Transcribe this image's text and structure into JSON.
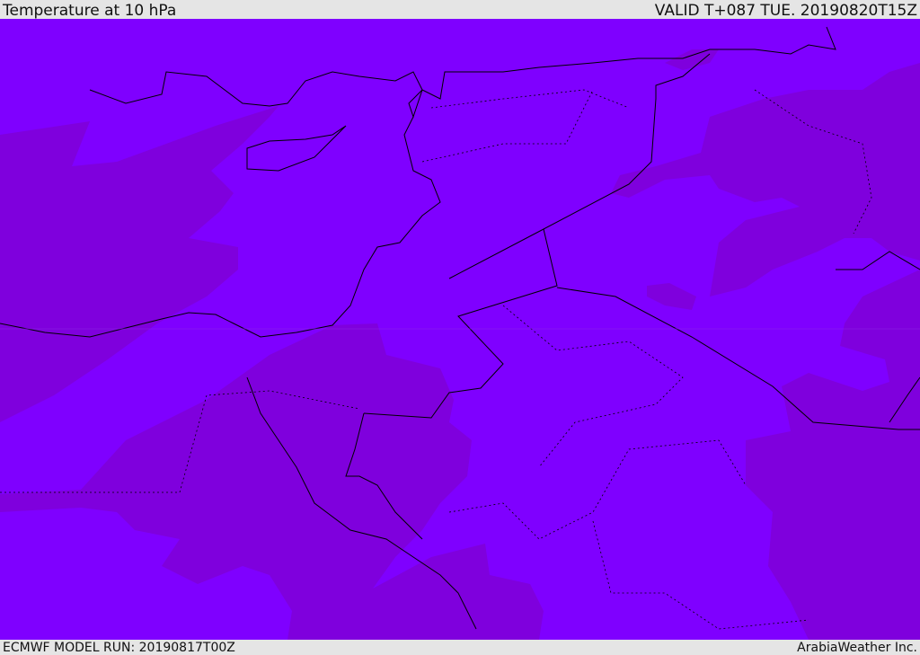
{
  "header": {
    "title": "Temperature at 10 hPa",
    "valid": "VALID T+087 TUE. 20190820T15Z"
  },
  "footer": {
    "model_run": "ECMWF MODEL RUN: 20190817T00Z",
    "credit": "ArabiaWeather Inc."
  },
  "colors": {
    "light_band": "#7f00ff",
    "dark_band": "#7f00dd",
    "coast": "#000000"
  }
}
